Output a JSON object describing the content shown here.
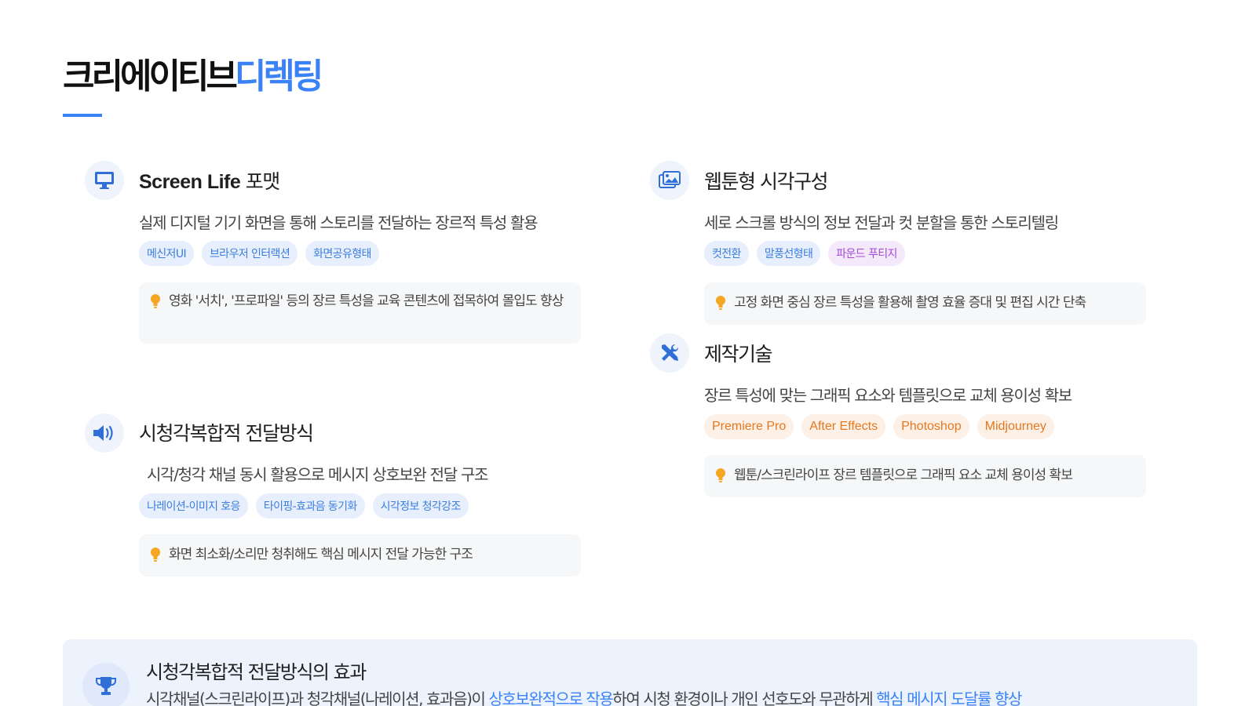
{
  "header": {
    "title_main": "크리에이티브",
    "title_accent": "디렉팅"
  },
  "sections": {
    "screen_life": {
      "icon": "monitor-icon",
      "title_en": "Screen Life",
      "title_ko": "포맷",
      "desc": "실제 디지털 기기 화면을 통해 스토리를 전달하는 장르적 특성 활용",
      "tags": [
        "메신저UI",
        "브라우저 인터랙션",
        "화면공유형태"
      ],
      "tip": "영화 '서치', '프로파일' 등의 장르 특성을 교육 콘텐츠에 접목하여 몰입도 향상"
    },
    "audiovisual": {
      "icon": "speaker-icon",
      "title": "시청각복합적 전달방식",
      "desc": "시각/청각 채널 동시 활용으로 메시지 상호보완 전달 구조",
      "tags": [
        "나레이션-이미지 호응",
        "타이핑-효과음 동기화",
        "시각정보 청각강조"
      ],
      "tip": "화면 최소화/소리만 청취해도 핵심 메시지 전달 가능한 구조"
    },
    "webtoon": {
      "icon": "images-icon",
      "title": "웹툰형 시각구성",
      "desc": "세로 스크롤 방식의 정보 전달과 컷 분할을 통한 스토리텔링",
      "tags": [
        "컷전환",
        "말풍선형태",
        "파운드 푸티지"
      ],
      "tip": "고정 화면 중심 장르 특성을 활용해 촬영 효율 증대 및 편집 시간 단축"
    },
    "production": {
      "icon": "tools-icon",
      "title": "제작기술",
      "desc": "장르 특성에 맞는 그래픽 요소와 템플릿으로 교체 용이성 확보",
      "tags": [
        "Premiere Pro",
        "After Effects",
        "Photoshop",
        "Midjourney"
      ],
      "tip": "웹툰/스크린라이프 장르 템플릿으로 그래픽 요소 교체 용이성 확보"
    }
  },
  "effect": {
    "icon": "trophy-icon",
    "title": "시청각복합적 전달방식의 효과",
    "desc_part1": "시각채널(스크린라이프)과 청각채널(나레이션, 효과음)이 ",
    "desc_hl1": "상호보완적으로 작용",
    "desc_part2": "하여 시청 환경이나 개인 선호도와 무관하게 ",
    "desc_hl2": "핵심 메시지 도달률 향상"
  },
  "colors": {
    "accent": "#3b82f6",
    "tip_bulb": "#f5a623",
    "orange_tag": "#e5781f",
    "purple_tag": "#a34bd4"
  }
}
